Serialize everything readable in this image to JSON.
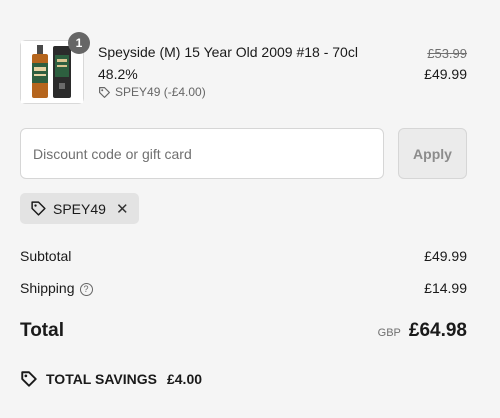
{
  "cart": {
    "item": {
      "quantity": "1",
      "title": "Speyside (M) 15 Year Old 2009 #18 - 70cl",
      "abv": "48.2%",
      "discount_line": "SPEY49 (-£4.00)",
      "original_price": "£53.99",
      "price": "£49.99",
      "thumbnail_icon": "whisky-bottle-with-tube-image"
    }
  },
  "discount": {
    "placeholder": "Discount code or gift card",
    "value": "",
    "apply_label": "Apply",
    "applied_code": "SPEY49"
  },
  "summary": {
    "subtotal_label": "Subtotal",
    "subtotal_value": "£49.99",
    "shipping_label": "Shipping",
    "shipping_value": "£14.99",
    "help_icon_glyph": "?",
    "total_label": "Total",
    "currency": "GBP",
    "total_value": "£64.98",
    "savings_label": "TOTAL SAVINGS",
    "savings_value": "£4.00"
  },
  "colors": {
    "background": "#f5f5f5",
    "text": "#1a1a1a",
    "muted": "#707070",
    "chip_bg": "#e3e3e3",
    "badge_bg": "#666666"
  }
}
